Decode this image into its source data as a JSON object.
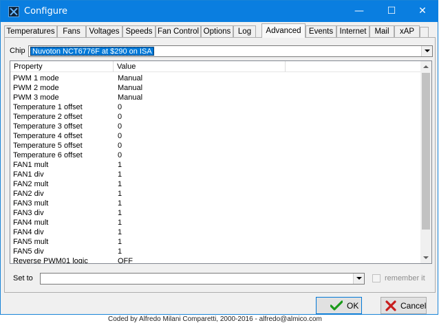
{
  "window": {
    "title": "Configure",
    "minimize_glyph": "—",
    "maximize_glyph": "☐",
    "close_glyph": "✕",
    "accent_color": "#0a7ee0"
  },
  "tabs": [
    {
      "label": "Temperatures",
      "active": false
    },
    {
      "label": "Fans",
      "active": false
    },
    {
      "label": "Voltages",
      "active": false
    },
    {
      "label": "Speeds",
      "active": false
    },
    {
      "label": "Fan Control",
      "active": false
    },
    {
      "label": "Options",
      "active": false
    },
    {
      "label": "Log",
      "active": false
    },
    {
      "label": "Advanced",
      "active": true
    },
    {
      "label": "Events",
      "active": false
    },
    {
      "label": "Internet",
      "active": false
    },
    {
      "label": "Mail",
      "active": false
    },
    {
      "label": "xAP",
      "active": false
    }
  ],
  "chip": {
    "label": "Chip",
    "selected": "Nuvoton NCT6776F at $290 on ISA"
  },
  "table": {
    "columns": [
      "Property",
      "Value"
    ],
    "rows": [
      {
        "property": "PWM 1 mode",
        "value": "Manual"
      },
      {
        "property": "PWM 2 mode",
        "value": "Manual"
      },
      {
        "property": "PWM 3 mode",
        "value": "Manual"
      },
      {
        "property": "Temperature 1 offset",
        "value": "0"
      },
      {
        "property": "Temperature 2 offset",
        "value": "0"
      },
      {
        "property": "Temperature 3 offset",
        "value": "0"
      },
      {
        "property": "Temperature 4 offset",
        "value": "0"
      },
      {
        "property": "Temperature 5 offset",
        "value": "0"
      },
      {
        "property": "Temperature 6 offset",
        "value": "0"
      },
      {
        "property": "FAN1 mult",
        "value": "1"
      },
      {
        "property": "FAN1 div",
        "value": "1"
      },
      {
        "property": "FAN2 mult",
        "value": "1"
      },
      {
        "property": "FAN2 div",
        "value": "1"
      },
      {
        "property": "FAN3 mult",
        "value": "1"
      },
      {
        "property": "FAN3 div",
        "value": "1"
      },
      {
        "property": "FAN4 mult",
        "value": "1"
      },
      {
        "property": "FAN4 div",
        "value": "1"
      },
      {
        "property": "FAN5 mult",
        "value": "1"
      },
      {
        "property": "FAN5 div",
        "value": "1"
      },
      {
        "property": "Reverse PWM01 logic",
        "value": "OFF"
      }
    ]
  },
  "set_to": {
    "label": "Set to",
    "value": "",
    "remember_label": "remember it",
    "remember_checked": false
  },
  "buttons": {
    "ok_label": "OK",
    "cancel_label": "Cancel"
  },
  "footer_text": "Coded by Alfredo Milani Comparetti, 2000-2016 - alfredo@almico.com"
}
